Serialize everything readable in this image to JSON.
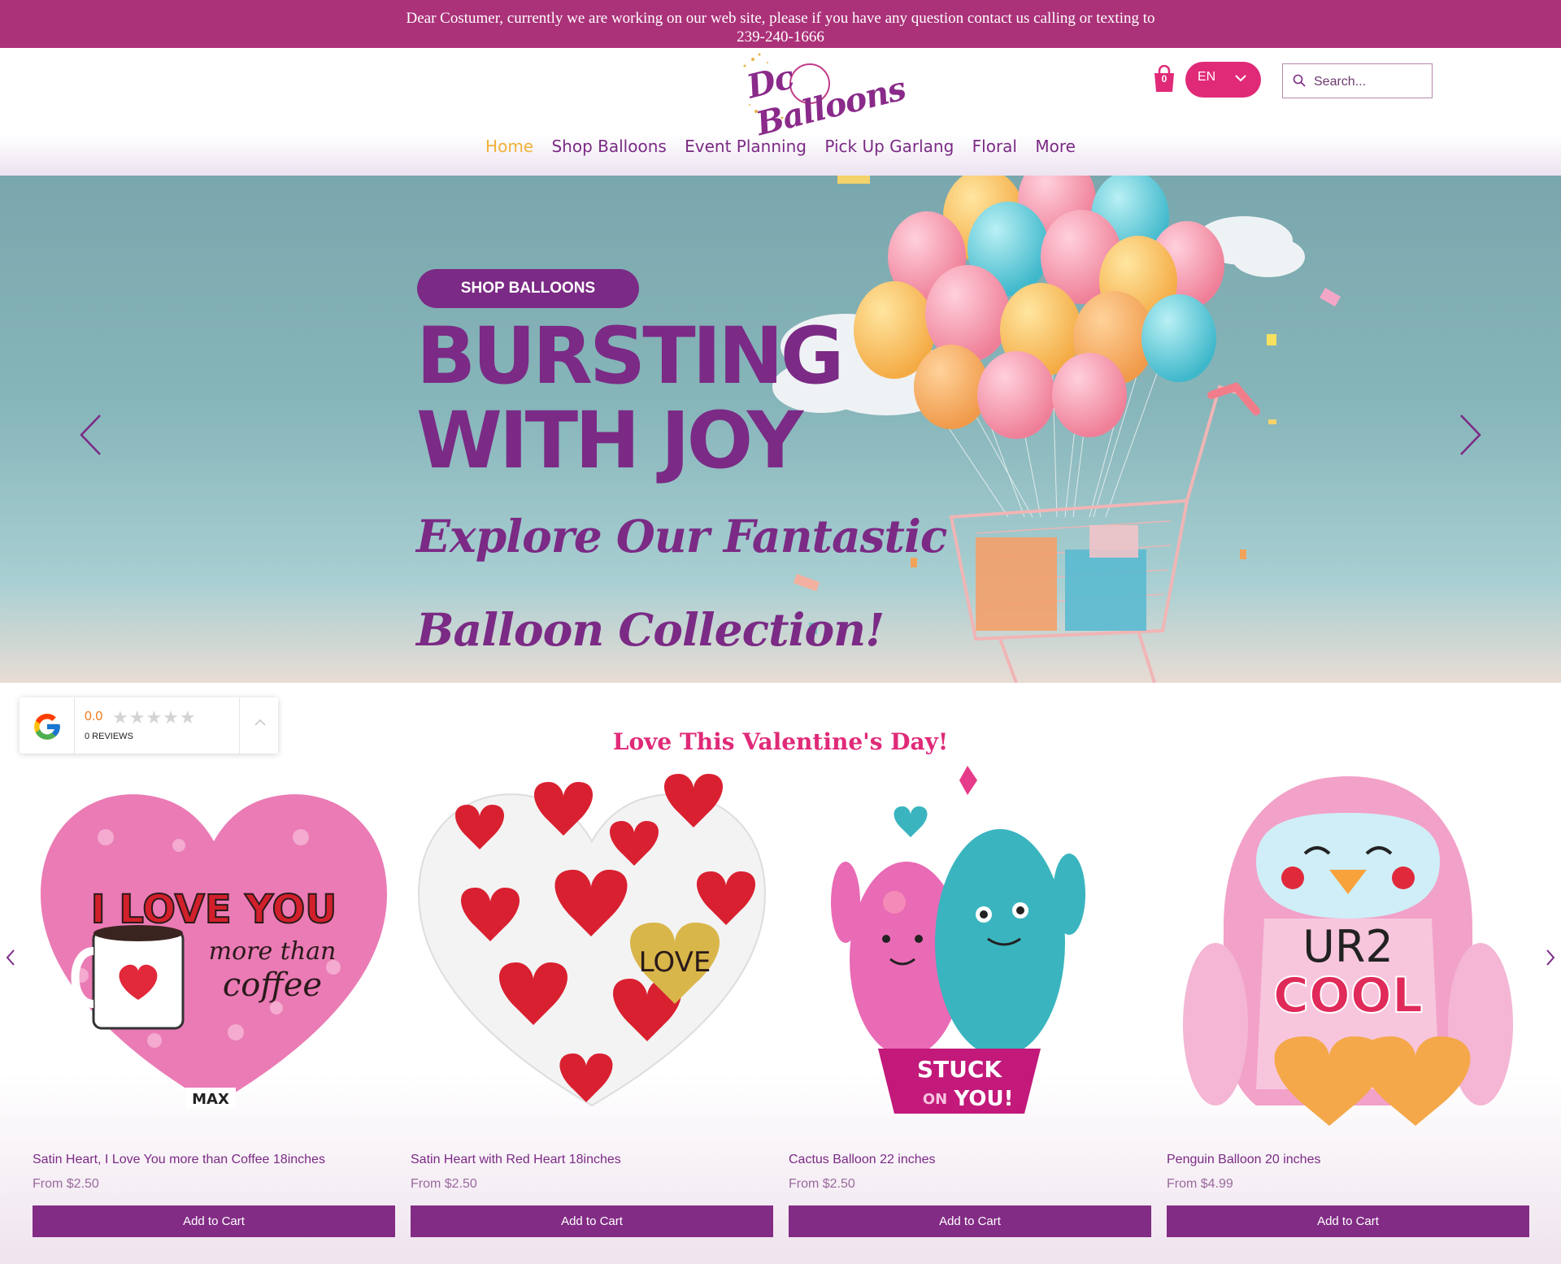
{
  "announcement": {
    "line1": "Dear Costumer, currently we are working on our web site, please if you have any question contact us calling or texting to",
    "line2": "239-240-1666"
  },
  "header": {
    "logo_text": "Dc Balloons",
    "cart_count": "0",
    "language": "EN",
    "search_placeholder": "Search..."
  },
  "nav": {
    "items": [
      "Home",
      "Shop Balloons",
      "Event Planning",
      "Pick Up Garlang",
      "Floral",
      "More"
    ],
    "active": "Home"
  },
  "hero": {
    "button_label": "SHOP BALLOONS",
    "headline_line1": "BURSTING",
    "headline_line2": "WITH JOY",
    "subline_line1": "Explore Our Fantastic",
    "subline_line2": "Balloon Collection!"
  },
  "reviews": {
    "score": "0.0",
    "stars": "★★★★★",
    "count": "0 REVIEWS"
  },
  "section": {
    "title": "Love This Valentine's Day!"
  },
  "products": [
    {
      "name": "Satin Heart, I Love You more than Coffee 18inches",
      "price": "From $2.50",
      "button": "Add to Cart",
      "art_text1": "I LOVE YOU",
      "art_text2": "more than",
      "art_text3": "coffee",
      "art_badge": "MAX"
    },
    {
      "name": "Satin Heart with Red Heart 18inches",
      "price": "From $2.50",
      "button": "Add to Cart",
      "art_text1": "LOVE"
    },
    {
      "name": "Cactus Balloon 22 inches",
      "price": "From $2.50",
      "button": "Add to Cart",
      "art_text1": "STUCK",
      "art_text2": "ON",
      "art_text3": "YOU!"
    },
    {
      "name": "Penguin Balloon 20 inches",
      "price": "From $4.99",
      "button": "Add to Cart",
      "art_text1": "UR2",
      "art_text2": "COOL"
    }
  ],
  "colors": {
    "brand_purple": "#7b2a85",
    "announcement_bar": "#ab3279",
    "accent_pink": "#e02a78",
    "nav_active": "#f0b13a"
  },
  "icons": [
    "search-icon",
    "cart-icon",
    "chevron-down-icon",
    "chevron-left-icon",
    "chevron-right-icon",
    "google-icon",
    "chevron-up-icon"
  ]
}
